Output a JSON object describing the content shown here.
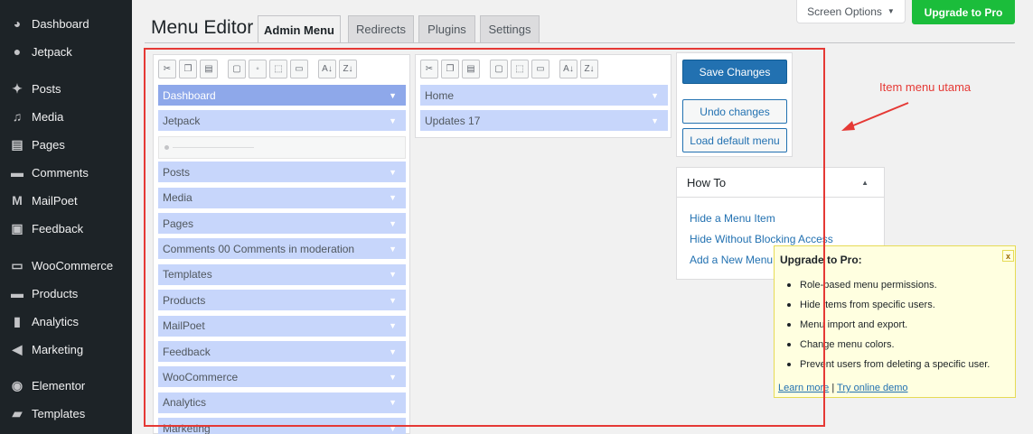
{
  "sidebar": {
    "items": [
      {
        "label": "Dashboard",
        "icon": "dashboard-icon",
        "glyph": "◕"
      },
      {
        "label": "Jetpack",
        "icon": "jetpack-icon",
        "glyph": "●"
      },
      {
        "label": "Posts",
        "icon": "pin-icon",
        "glyph": "✦"
      },
      {
        "label": "Media",
        "icon": "media-icon",
        "glyph": "♫"
      },
      {
        "label": "Pages",
        "icon": "pages-icon",
        "glyph": "▤"
      },
      {
        "label": "Comments",
        "icon": "comments-icon",
        "glyph": "▬"
      },
      {
        "label": "MailPoet",
        "icon": "mailpoet-icon",
        "glyph": "M"
      },
      {
        "label": "Feedback",
        "icon": "feedback-icon",
        "glyph": "▣"
      },
      {
        "label": "WooCommerce",
        "icon": "woocommerce-icon",
        "glyph": "▭"
      },
      {
        "label": "Products",
        "icon": "products-icon",
        "glyph": "▬"
      },
      {
        "label": "Analytics",
        "icon": "analytics-icon",
        "glyph": "▮"
      },
      {
        "label": "Marketing",
        "icon": "marketing-icon",
        "glyph": "◀"
      },
      {
        "label": "Elementor",
        "icon": "elementor-icon",
        "glyph": "◉"
      },
      {
        "label": "Templates",
        "icon": "folder-icon",
        "glyph": "▰"
      }
    ]
  },
  "header": {
    "screen_options": "Screen Options",
    "screen_options_arrow": "▼",
    "upgrade_button": "Upgrade to Pro",
    "title": "Menu Editor"
  },
  "tabs": [
    {
      "label": "Admin Menu",
      "active": true
    },
    {
      "label": "Redirects",
      "active": false
    },
    {
      "label": "Plugins",
      "active": false
    },
    {
      "label": "Settings",
      "active": false
    }
  ],
  "toolbar": {
    "left": [
      "cut-icon",
      "copy-icon",
      "paste-icon",
      "new-item-icon",
      "new-separator-icon",
      "hide-icon",
      "delete-icon",
      "sort-asc-icon",
      "sort-desc-icon"
    ],
    "right": [
      "cut-icon",
      "copy-icon",
      "paste-icon",
      "new-item-icon",
      "hide-icon",
      "delete-icon",
      "sort-asc-icon",
      "sort-desc-icon"
    ]
  },
  "left_menu": {
    "items": [
      {
        "label": "Dashboard",
        "selected": true
      },
      {
        "label": "Jetpack"
      },
      {
        "separator": true
      },
      {
        "label": "Posts"
      },
      {
        "label": "Media"
      },
      {
        "label": "Pages"
      },
      {
        "label": "Comments 00 Comments in moderation"
      },
      {
        "label": "Templates"
      },
      {
        "label": "Products"
      },
      {
        "label": "MailPoet"
      },
      {
        "label": "Feedback"
      },
      {
        "label": "WooCommerce"
      },
      {
        "label": "Analytics"
      },
      {
        "label": "Marketing"
      }
    ]
  },
  "right_menu": {
    "items": [
      {
        "label": "Home"
      },
      {
        "label": "Updates 17"
      }
    ]
  },
  "actions": {
    "save": "Save Changes",
    "undo": "Undo changes",
    "load_default": "Load default menu"
  },
  "howto": {
    "title": "How To",
    "links": [
      "Hide a Menu Item",
      "Hide Without Blocking Access",
      "Add a New Menu"
    ]
  },
  "upgrade_box": {
    "title": "Upgrade to Pro:",
    "close": "x",
    "features": [
      "Role-based menu permissions.",
      "Hide items from specific users.",
      "Menu import and export.",
      "Change menu colors.",
      "Prevent users from deleting a specific user."
    ],
    "learn_more": "Learn more",
    "divider": " | ",
    "demo": "Try online demo"
  },
  "annotation": {
    "text": "Item menu utama",
    "color": "#e53935"
  },
  "colors": {
    "sidebar_bg": "#1d2327",
    "menu_item": "#c7d6fb",
    "menu_item_selected": "#8ea8ea",
    "primary": "#2271b1",
    "upgrade_green": "#1bbd3b"
  }
}
